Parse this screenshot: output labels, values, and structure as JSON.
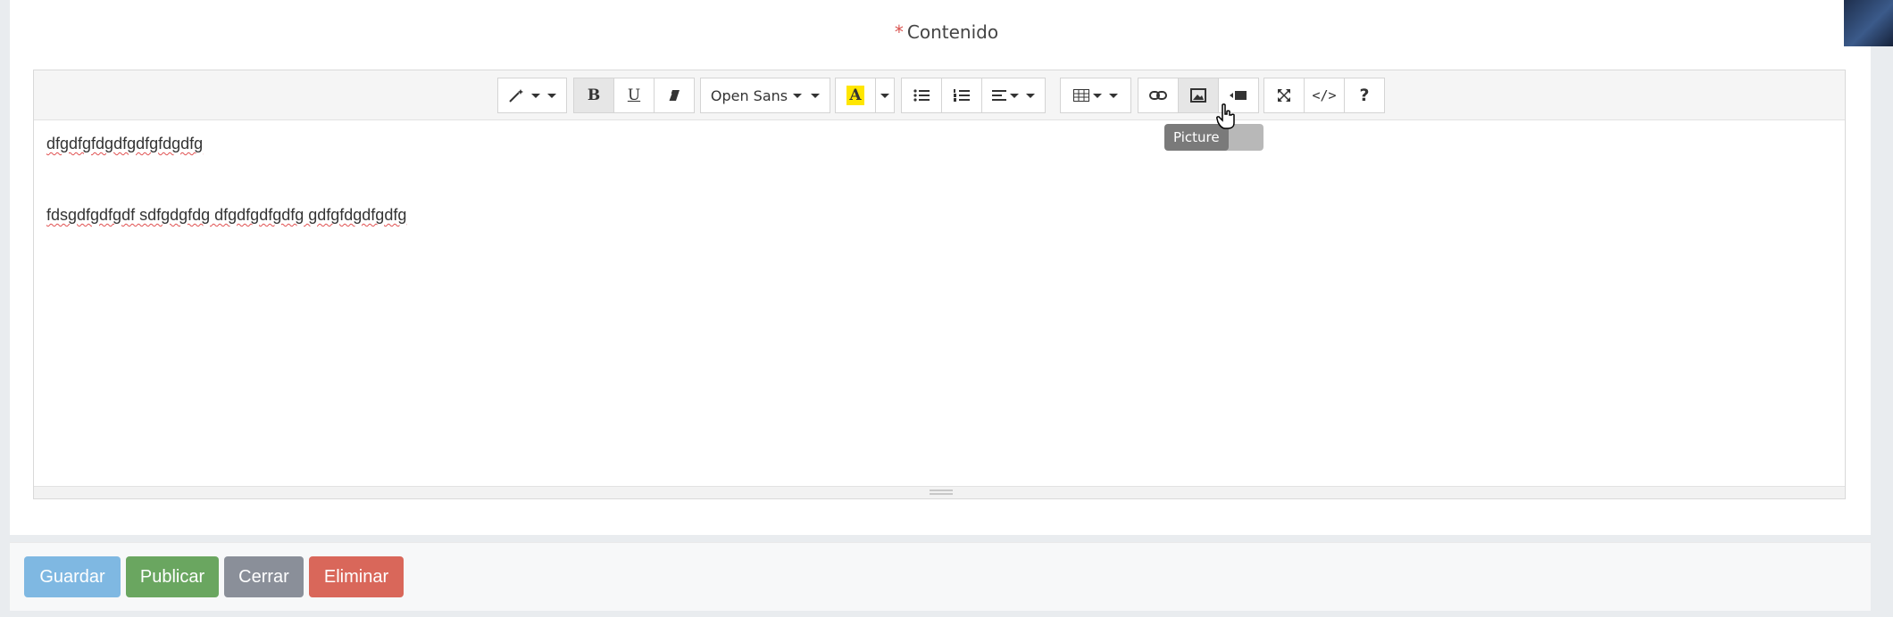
{
  "field": {
    "required_mark": "*",
    "label": "Contenido"
  },
  "toolbar": {
    "font_name": "Open Sans",
    "bold_glyph": "B",
    "underline_glyph": "U",
    "code_glyph": "</>",
    "help_glyph": "?",
    "highlight_glyph": "A",
    "highlight_color": "#ffe600"
  },
  "tooltip": {
    "text": "Picture"
  },
  "editor": {
    "line1": "dfgdfgfdgdfgdfgfdgdfg",
    "line2": "fdsgdfgdfgdf sdfgdgfdg dfgdfgdfgdfg gdfgfdgdfgdfg"
  },
  "actions": {
    "save": "Guardar",
    "publish": "Publicar",
    "close": "Cerrar",
    "delete": "Eliminar"
  },
  "colors": {
    "save": "#7fb8e2",
    "publish": "#6aa660",
    "close": "#8a8f99",
    "delete": "#d9675a",
    "required": "#d9534f"
  }
}
